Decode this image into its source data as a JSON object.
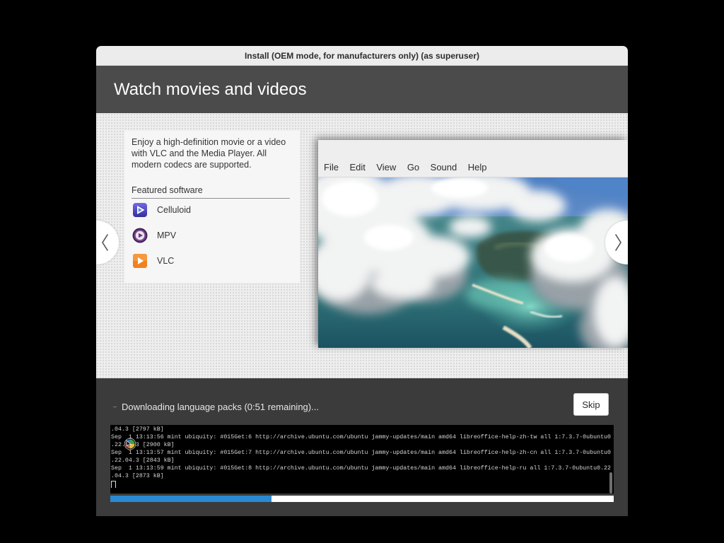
{
  "window": {
    "title": "Install (OEM mode, for manufacturers only) (as superuser)"
  },
  "slide": {
    "heading": "Watch movies and videos",
    "description_lines": [
      "Enjoy a high-definition movie or a video",
      "with VLC and the Media Player. All",
      "modern codecs are supported."
    ],
    "featured_heading": "Featured software",
    "featured": [
      {
        "label": "Celluloid",
        "icon": "celluloid-icon"
      },
      {
        "label": "MPV",
        "icon": "mpv-icon"
      },
      {
        "label": "VLC",
        "icon": "vlc-icon"
      }
    ],
    "screenshot": {
      "menu": [
        "File",
        "Edit",
        "View",
        "Go",
        "Sound",
        "Help"
      ]
    },
    "prev_icon": "chevron-left-icon",
    "next_icon": "chevron-right-icon"
  },
  "progress": {
    "spinner_icon": "spinner-icon",
    "status": "Downloading language packs (0:51 remaining)...",
    "skip_label": "Skip",
    "fraction": 0.32,
    "log": [
      ".04.3 [2797 kB]",
      "Sep  1 13:13:56 mint ubiquity: #015Get:6 http://archive.ubuntu.com/ubuntu jammy-updates/main amd64 libreoffice-help-zh-tw all 1:7.3.7-0ubuntu0",
      ".22.04.3 [2900 kB]",
      "Sep  1 13:13:57 mint ubiquity: #015Get:7 http://archive.ubuntu.com/ubuntu jammy-updates/main amd64 libreoffice-help-zh-cn all 1:7.3.7-0ubuntu0",
      ".22.04.3 [2843 kB]",
      "Sep  1 13:13:59 mint ubiquity: #015Get:8 http://archive.ubuntu.com/ubuntu jammy-updates/main amd64 libreoffice-help-ru all 1:7.3.7-0ubuntu0.22",
      ".04.3 [2873 kB]"
    ],
    "mouse_cursor_icon": "busy-cursor-icon"
  },
  "colors": {
    "titlebar": "#ececec",
    "header": "#4b4b4b",
    "footer": "#3b3b3b",
    "terminal_bg": "#000000",
    "terminal_text": "#d4d4d4",
    "progress_track": "#ffffff",
    "progress_fill": "#2a89d1"
  }
}
